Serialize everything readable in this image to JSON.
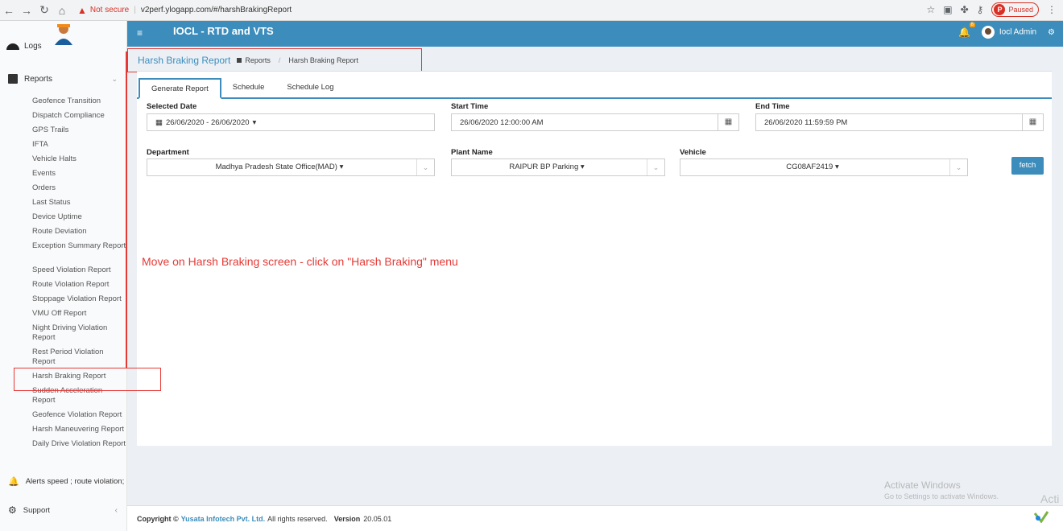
{
  "browser": {
    "not_secure": "Not secure",
    "url": "v2perf.ylogapp.com/#/harshBrakingReport",
    "paused": "Paused",
    "profile_initial": "P"
  },
  "header": {
    "title": "IOCL - RTD and VTS",
    "notification_count": "8",
    "user": "Iocl Admin"
  },
  "sidebar": {
    "logs": "Logs",
    "reports": "Reports",
    "items": [
      "Geofence Transition",
      "Dispatch Compliance",
      "GPS Trails",
      "IFTA",
      "Vehicle Halts",
      "Events",
      "Orders",
      "Last Status",
      "Device Uptime",
      "Route Deviation",
      "Exception Summary Report",
      "Speed Violation Report",
      "Route Violation Report",
      "Stoppage Violation Report",
      "VMU Off Report",
      "Night Driving Violation Report",
      "Rest Period Violation Report",
      "Harsh Braking Report",
      "Sudden Acceleration Report",
      "Geofence Violation Report",
      "Harsh Maneuvering Report",
      "Daily Drive Violation Report"
    ],
    "alerts": "Alerts speed ; route violation;",
    "support": "Support"
  },
  "breadcrumb": {
    "title": "Harsh Braking Report",
    "parent": "Reports",
    "current": "Harsh Braking Report"
  },
  "tabs": [
    "Generate Report",
    "Schedule",
    "Schedule Log"
  ],
  "form": {
    "selected_date_label": "Selected Date",
    "selected_date_value": "26/06/2020 - 26/06/2020",
    "start_time_label": "Start Time",
    "start_time_value": "26/06/2020 12:00:00 AM",
    "end_time_label": "End Time",
    "end_time_value": "26/06/2020 11:59:59 PM",
    "department_label": "Department",
    "department_value": "Madhya Pradesh State Office(MAD)",
    "plant_label": "Plant Name",
    "plant_value": "RAIPUR BP Parking",
    "vehicle_label": "Vehicle",
    "vehicle_value": "CG08AF2419",
    "fetch": "fetch"
  },
  "annotation": "Move on Harsh Braking screen - click on \"Harsh Braking\" menu",
  "footer": {
    "copyright": "Copyright ©",
    "company": "Yusata Infotech Pvt. Ltd.",
    "rights": "All rights reserved.",
    "version_label": "Version",
    "version": "20.05.01"
  },
  "watermark": {
    "line1": "Activate Windows",
    "line2": "Go to Settings to activate Windows.",
    "fragment": "Acti"
  },
  "colors": {
    "header_blue": "#3c8dbc",
    "annotation_red": "#e53935"
  }
}
